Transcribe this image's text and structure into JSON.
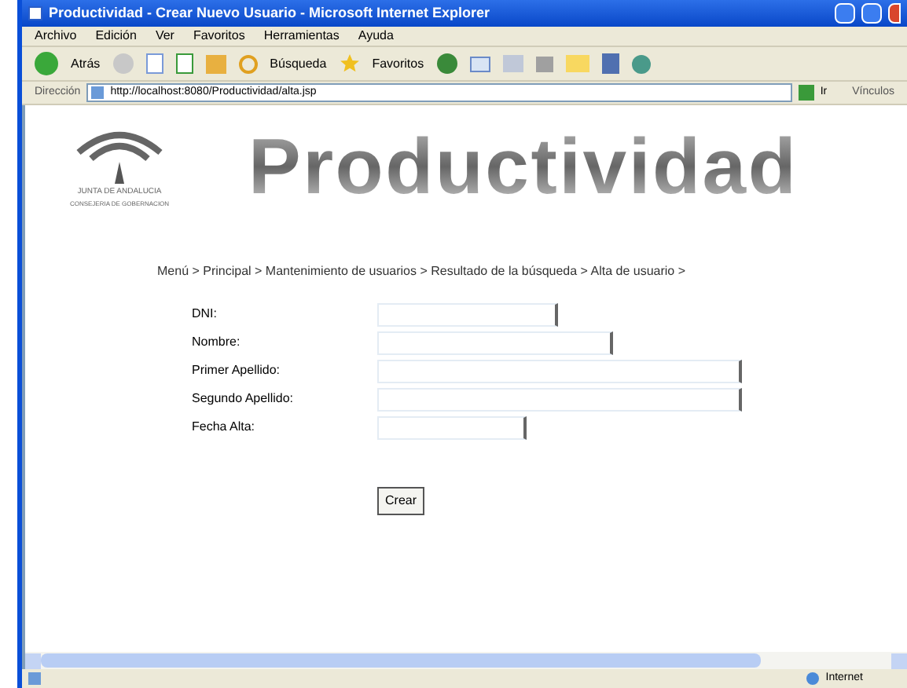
{
  "window": {
    "title": "Productividad - Crear Nuevo Usuario - Microsoft Internet Explorer"
  },
  "menu": [
    "Archivo",
    "Edición",
    "Ver",
    "Favoritos",
    "Herramientas",
    "Ayuda"
  ],
  "toolbar": {
    "back": "Atrás",
    "search": "Búsqueda",
    "favorites": "Favoritos"
  },
  "address": {
    "label": "Dirección",
    "value": "http://localhost:8080/Productividad/alta.jsp",
    "go": "Ir",
    "links": "Vínculos"
  },
  "page": {
    "logo_text": "JUNTA DE ANDALUCIA",
    "logo_subtext": "CONSEJERIA DE GOBERNACION",
    "heading": "Productividad",
    "breadcrumb": "Menú > Principal > Mantenimiento de usuarios > Resultado de la búsqueda > Alta de usuario >",
    "fields": [
      {
        "label": "DNI:"
      },
      {
        "label": "Nombre:"
      },
      {
        "label": "Primer Apellido:"
      },
      {
        "label": "Segundo Apellido:"
      },
      {
        "label": "Fecha Alta:"
      }
    ],
    "submit": "Crear"
  },
  "status_bar": {
    "zone": "Internet"
  }
}
